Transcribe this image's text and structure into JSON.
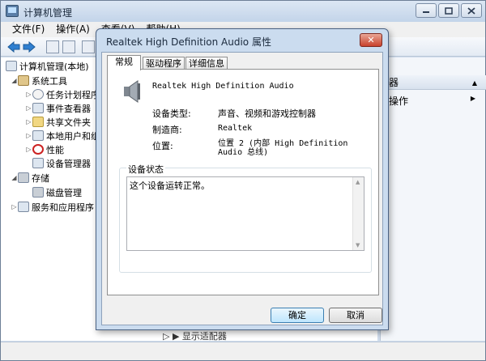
{
  "main": {
    "title": "计算机管理",
    "menus": [
      "文件(F)",
      "操作(A)",
      "查看(V)",
      "帮助(H)"
    ]
  },
  "tree": {
    "items": [
      {
        "label": "计算机管理(本地)"
      },
      {
        "label": "系统工具"
      },
      {
        "label": "任务计划程序"
      },
      {
        "label": "事件查看器"
      },
      {
        "label": "共享文件夹"
      },
      {
        "label": "本地用户和组"
      },
      {
        "label": "性能"
      },
      {
        "label": "设备管理器"
      },
      {
        "label": "存储"
      },
      {
        "label": "磁盘管理"
      },
      {
        "label": "服务和应用程序"
      }
    ]
  },
  "actions": {
    "header": "器",
    "item": "操作"
  },
  "bottom_item": "显示适配器",
  "dialog": {
    "title": "Realtek High Definition Audio 属性",
    "close": "✕",
    "tabs": [
      "常规",
      "驱动程序",
      "详细信息"
    ],
    "device_name": "Realtek High Definition Audio",
    "device_type_label": "设备类型:",
    "device_type_value": "声音、视频和游戏控制器",
    "manufacturer_label": "制造商:",
    "manufacturer_value": "Realtek",
    "location_label": "位置:",
    "location_value": "位置 2 (内部 High Definition Audio 总线)",
    "status_group": "设备状态",
    "status_text": "这个设备运转正常。",
    "ok": "确定",
    "cancel": "取消"
  }
}
